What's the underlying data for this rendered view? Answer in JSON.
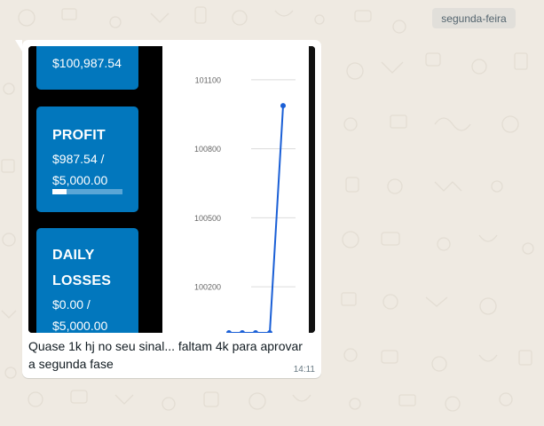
{
  "chat": {
    "date_chip": "segunda-feira"
  },
  "message": {
    "caption": "Quase 1k hj no seu sinal... faltam 4k para aprovar a segunda fase",
    "time": "14:11"
  },
  "screenshot": {
    "balance_value": "$100,987.54",
    "profit": {
      "title": "PROFIT",
      "value_line1": "$987.54 /",
      "value_line2": "$5,000.00",
      "progress": 0.1975
    },
    "daily_losses": {
      "title_line1": "DAILY",
      "title_line2": "LOSSES",
      "value_line1": "$0.00 /",
      "value_line2": "$5,000.00"
    },
    "chart_data": {
      "type": "line",
      "y_ticks": [
        101100,
        100800,
        100500,
        100200
      ],
      "ylim": [
        100000,
        101200
      ],
      "grid": true,
      "color": "#1a5fd6",
      "series": [
        {
          "values": [
            100000,
            100000,
            100000,
            100000,
            100987.54
          ]
        }
      ]
    }
  },
  "colors": {
    "card_blue": "#0277bd",
    "wallpaper": "#efeae2",
    "bubble": "#ffffff",
    "line": "#1a5fd6"
  }
}
